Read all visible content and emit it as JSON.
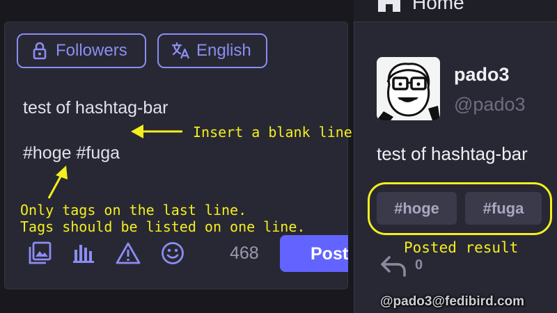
{
  "compose": {
    "privacy_label": "Followers",
    "language_label": "English",
    "text_line1": "test of hashtag-bar",
    "text_line2": "#hoge #fuga",
    "char_count": "468",
    "post_label": "Post"
  },
  "annotations": {
    "insert_blank": "Insert a blank line",
    "only_tags": "Only tags on the last line.",
    "one_line": "Tags should be listed on one line.",
    "posted_result": "Posted result",
    "color": "#f4ef1f"
  },
  "column": {
    "title": "Home"
  },
  "status": {
    "display_name": "pado3",
    "username": "@pado3",
    "text": "test of hashtag-bar",
    "hashtags": [
      "#hoge",
      "#fuga"
    ],
    "reply_count": "0"
  },
  "watermark": "@pado3@fedibird.com",
  "colors": {
    "accent": "#8c8df2",
    "post_button": "#6364ff",
    "background": "#18181e",
    "panel": "#282834"
  },
  "icons": [
    "lock-icon",
    "translate-icon",
    "image-icon",
    "poll-icon",
    "warning-icon",
    "emoji-icon",
    "home-icon",
    "reply-icon"
  ]
}
